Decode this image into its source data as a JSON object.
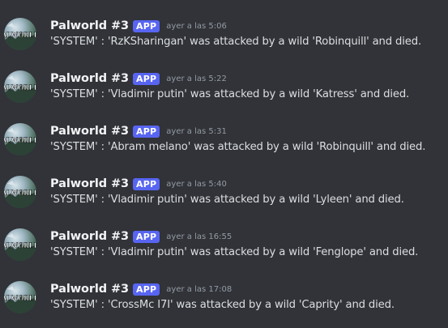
{
  "icons": {
    "avatar": "palworld-logo-avatar"
  },
  "colors": {
    "background": "#313338",
    "username": "#f2f3f5",
    "badge": "#5865f2",
    "timestamp": "#949ba4",
    "text": "#dbdee1"
  },
  "avatar_text": "ALWORLD",
  "messages": [
    {
      "author": "Palworld #3",
      "badge": "APP",
      "timestamp": "ayer a las 5:06",
      "content": "'SYSTEM' : 'RzKSharingan' was attacked by a wild 'Robinquill' and died."
    },
    {
      "author": "Palworld #3",
      "badge": "APP",
      "timestamp": "ayer a las 5:22",
      "content": "'SYSTEM' : 'Vladimir putin' was attacked by a wild 'Katress' and died."
    },
    {
      "author": "Palworld #3",
      "badge": "APP",
      "timestamp": "ayer a las 5:31",
      "content": "'SYSTEM' : 'Abram melano' was attacked by a wild 'Robinquill' and died."
    },
    {
      "author": "Palworld #3",
      "badge": "APP",
      "timestamp": "ayer a las 5:40",
      "content": "'SYSTEM' : 'Vladimir putin' was attacked by a wild 'Lyleen' and died."
    },
    {
      "author": "Palworld #3",
      "badge": "APP",
      "timestamp": "ayer a las 16:55",
      "content": "'SYSTEM' : 'Vladimir putin' was attacked by a wild 'Fenglope' and died."
    },
    {
      "author": "Palworld #3",
      "badge": "APP",
      "timestamp": "ayer a las 17:08",
      "content": "'SYSTEM' : 'CrossMc I7I' was attacked by a wild 'Caprity' and died."
    }
  ]
}
